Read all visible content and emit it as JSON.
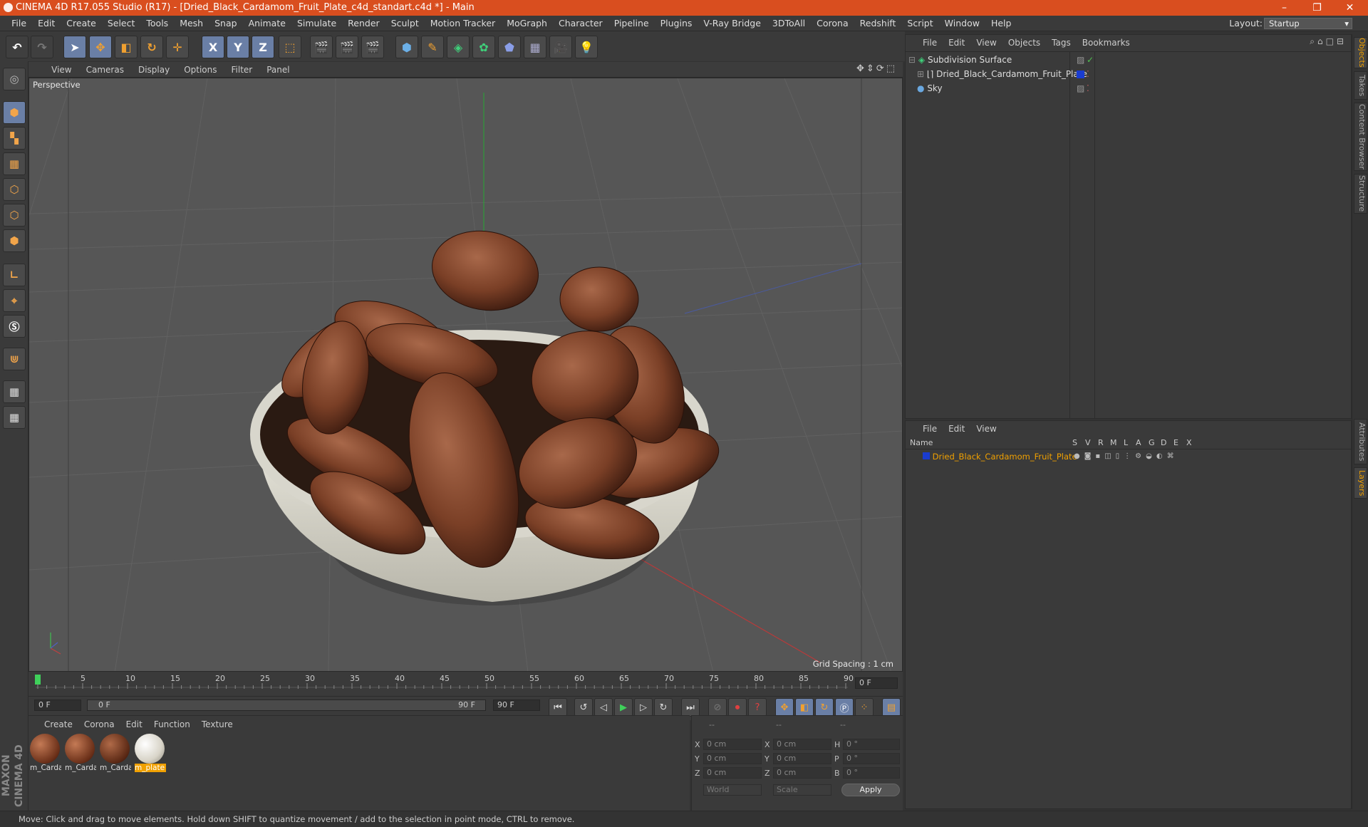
{
  "window": {
    "title": "CINEMA 4D R17.055 Studio (R17) - [Dried_Black_Cardamom_Fruit_Plate_c4d_standart.c4d *] - Main",
    "minimize": "–",
    "restore": "❐",
    "close": "✕"
  },
  "menubar": {
    "items": [
      "File",
      "Edit",
      "Create",
      "Select",
      "Tools",
      "Mesh",
      "Snap",
      "Animate",
      "Simulate",
      "Render",
      "Sculpt",
      "Motion Tracker",
      "MoGraph",
      "Character",
      "Pipeline",
      "Plugins",
      "V-Ray Bridge",
      "3DToAll",
      "Corona",
      "Redshift",
      "Script",
      "Window",
      "Help"
    ],
    "layout_label": "Layout:",
    "layout_value": "Startup"
  },
  "toolbar": {
    "x_label": "X",
    "y_label": "Y",
    "z_label": "Z"
  },
  "viewport": {
    "menu": [
      "View",
      "Cameras",
      "Display",
      "Options",
      "Filter",
      "Panel"
    ],
    "label": "Perspective",
    "grid_spacing": "Grid Spacing : 1 cm"
  },
  "timeline": {
    "ticks": [
      "0",
      "5",
      "10",
      "15",
      "20",
      "25",
      "30",
      "35",
      "40",
      "45",
      "50",
      "55",
      "60",
      "65",
      "70",
      "75",
      "80",
      "85",
      "90"
    ],
    "current": "0 F"
  },
  "transport": {
    "start": "0 F",
    "range_start": "0 F",
    "range_end": "90 F",
    "end": "90 F"
  },
  "materials": {
    "menu": [
      "Create",
      "Corona",
      "Edit",
      "Function",
      "Texture"
    ],
    "items": [
      {
        "label": "m_Carda"
      },
      {
        "label": "m_Carda"
      },
      {
        "label": "m_Carda"
      },
      {
        "label": "m_plate"
      }
    ]
  },
  "coords": {
    "headers": [
      "--",
      "--",
      "--"
    ],
    "rows": [
      {
        "a": "X",
        "av": "0 cm",
        "b": "X",
        "bv": "0 cm",
        "c": "H",
        "cv": "0 °"
      },
      {
        "a": "Y",
        "av": "0 cm",
        "b": "Y",
        "bv": "0 cm",
        "c": "P",
        "cv": "0 °"
      },
      {
        "a": "Z",
        "av": "0 cm",
        "b": "Z",
        "bv": "0 cm",
        "c": "B",
        "cv": "0 °"
      }
    ],
    "world": "World",
    "scale": "Scale",
    "apply": "Apply"
  },
  "objects": {
    "menu": [
      "File",
      "Edit",
      "View",
      "Objects",
      "Tags",
      "Bookmarks"
    ],
    "rows": [
      {
        "name": "Subdivision Surface"
      },
      {
        "name": "Dried_Black_Cardamom_Fruit_Plate"
      },
      {
        "name": "Sky"
      }
    ]
  },
  "layers": {
    "menu": [
      "File",
      "Edit",
      "View"
    ],
    "name_header": "Name",
    "cols": [
      "S",
      "V",
      "R",
      "M",
      "L",
      "A",
      "G",
      "D",
      "E",
      "X"
    ],
    "row": "Dried_Black_Cardamom_Fruit_Plate"
  },
  "sidetabs": [
    "Objects",
    "Takes",
    "Content Browser",
    "Structure",
    "Attributes",
    "Layers"
  ],
  "status": "Move: Click and drag to move elements. Hold down SHIFT to quantize movement / add to the selection in point mode, CTRL to remove.",
  "brand": "MAXON CINEMA 4D"
}
